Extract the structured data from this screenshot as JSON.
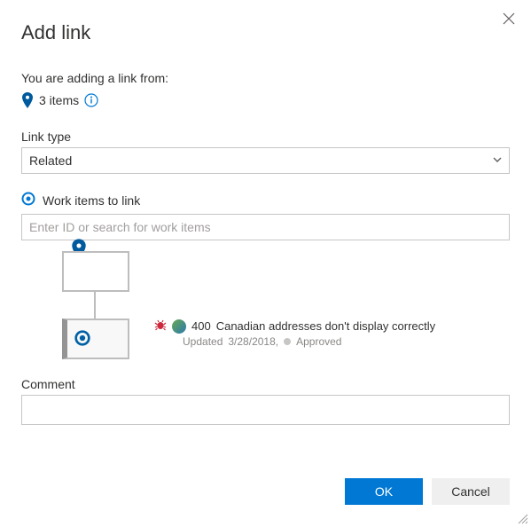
{
  "dialog": {
    "title": "Add link",
    "intro": "You are adding a link from:",
    "items_count_text": "3 items"
  },
  "link_type": {
    "label": "Link type",
    "value": "Related"
  },
  "work_items": {
    "label": "Work items to link",
    "placeholder": "Enter ID or search for work items",
    "selected": {
      "id": "400",
      "title": "Canadian addresses don't display correctly",
      "updated_label": "Updated",
      "updated_date": "3/28/2018,",
      "state": "Approved"
    }
  },
  "comment": {
    "label": "Comment",
    "value": ""
  },
  "buttons": {
    "ok": "OK",
    "cancel": "Cancel"
  }
}
